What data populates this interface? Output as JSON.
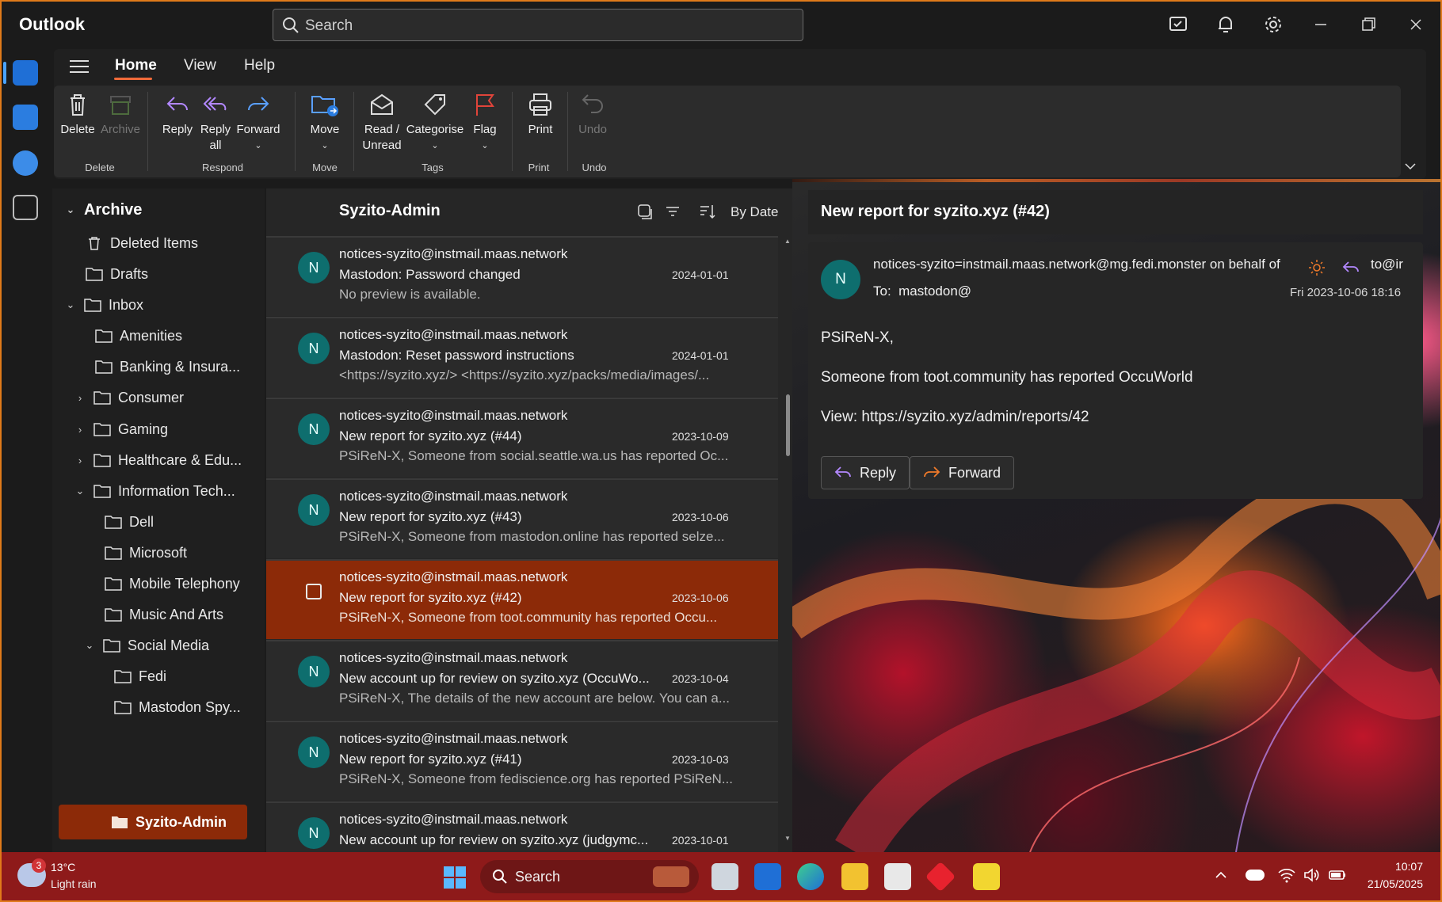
{
  "app": {
    "title": "Outlook"
  },
  "search": {
    "placeholder": "Search"
  },
  "menu": {
    "tabs": [
      "Home",
      "View",
      "Help"
    ]
  },
  "ribbon": {
    "delete": "Delete",
    "archive": "Archive",
    "reply": "Reply",
    "reply_all_1": "Reply",
    "reply_all_2": "all",
    "forward": "Forward",
    "move": "Move",
    "read_unread_1": "Read /",
    "read_unread_2": "Unread",
    "categorise": "Categorise",
    "flag": "Flag",
    "print": "Print",
    "undo": "Undo",
    "groups": {
      "delete": "Delete",
      "respond": "Respond",
      "move": "Move",
      "tags": "Tags",
      "print": "Print",
      "undo": "Undo"
    }
  },
  "folders": {
    "archive": "Archive",
    "deleted": "Deleted Items",
    "drafts": "Drafts",
    "inbox": "Inbox",
    "amenities": "Amenities",
    "banking": "Banking & Insura...",
    "consumer": "Consumer",
    "gaming": "Gaming",
    "healthcare": "Healthcare & Edu...",
    "infotech": "Information Tech...",
    "dell": "Dell",
    "microsoft": "Microsoft",
    "mobile": "Mobile Telephony",
    "music": "Music And Arts",
    "social": "Social Media",
    "fedi": "Fedi",
    "mastodon": "Mastodon Spy...",
    "syzito": "Syzito-Admin"
  },
  "list": {
    "title": "Syzito-Admin",
    "sort": "By Date",
    "messages": [
      {
        "avatar": "N",
        "from": "notices-syzito@instmail.maas.network",
        "subject": "Mastodon: Password changed",
        "date": "2024-01-01",
        "preview": "No preview is available."
      },
      {
        "avatar": "N",
        "from": "notices-syzito@instmail.maas.network",
        "subject": "Mastodon: Reset password instructions",
        "date": "2024-01-01",
        "preview": "<https://syzito.xyz/> <https://syzito.xyz/packs/media/images/..."
      },
      {
        "avatar": "N",
        "from": "notices-syzito@instmail.maas.network",
        "subject": "New report for syzito.xyz (#44)",
        "date": "2023-10-09",
        "preview": "PSiReN-X, Someone from social.seattle.wa.us has reported Oc..."
      },
      {
        "avatar": "N",
        "from": "notices-syzito@instmail.maas.network",
        "subject": "New report for syzito.xyz (#43)",
        "date": "2023-10-06",
        "preview": "PSiReN-X, Someone from mastodon.online has reported selze..."
      },
      {
        "avatar": "",
        "from": "notices-syzito@instmail.maas.network",
        "subject": "New report for syzito.xyz (#42)",
        "date": "2023-10-06",
        "preview": "PSiReN-X, Someone from toot.community has reported Occu..."
      },
      {
        "avatar": "N",
        "from": "notices-syzito@instmail.maas.network",
        "subject": "New account up for review on syzito.xyz (OccuWo...",
        "date": "2023-10-04",
        "preview": "PSiReN-X, The details of the new account are below. You can a..."
      },
      {
        "avatar": "N",
        "from": "notices-syzito@instmail.maas.network",
        "subject": "New report for syzito.xyz (#41)",
        "date": "2023-10-03",
        "preview": "PSiReN-X, Someone from fediscience.org has reported PSiReN..."
      },
      {
        "avatar": "N",
        "from": "notices-syzito@instmail.maas.network",
        "subject": "New account up for review on syzito.xyz (judgymc...",
        "date": "2023-10-01",
        "preview": ""
      }
    ]
  },
  "reading": {
    "title": "New report for syzito.xyz (#42)",
    "avatar": "N",
    "from": "notices-syzito=instmail.maas.network@mg.fedi.monster on behalf of",
    "to_label": "To:",
    "to": "mastodon@",
    "to_extra": "to@ir",
    "date": "Fri 2023-10-06 18:16",
    "greeting": "PSiReN-X,",
    "line1": "Someone from toot.community has reported OccuWorld",
    "line2": "View: https://syzito.xyz/admin/reports/42",
    "reply": "Reply",
    "forward": "Forward"
  },
  "taskbar": {
    "weather_temp": "13°C",
    "weather_desc": "Light rain",
    "weather_badge": "3",
    "search": "Search",
    "time": "10:07",
    "date": "21/05/2025"
  },
  "colors": {
    "accent": "#f26b3a",
    "selected": "#8c2a08",
    "avatar": "#0e6e6e",
    "taskbar": "#8e1a1a"
  }
}
